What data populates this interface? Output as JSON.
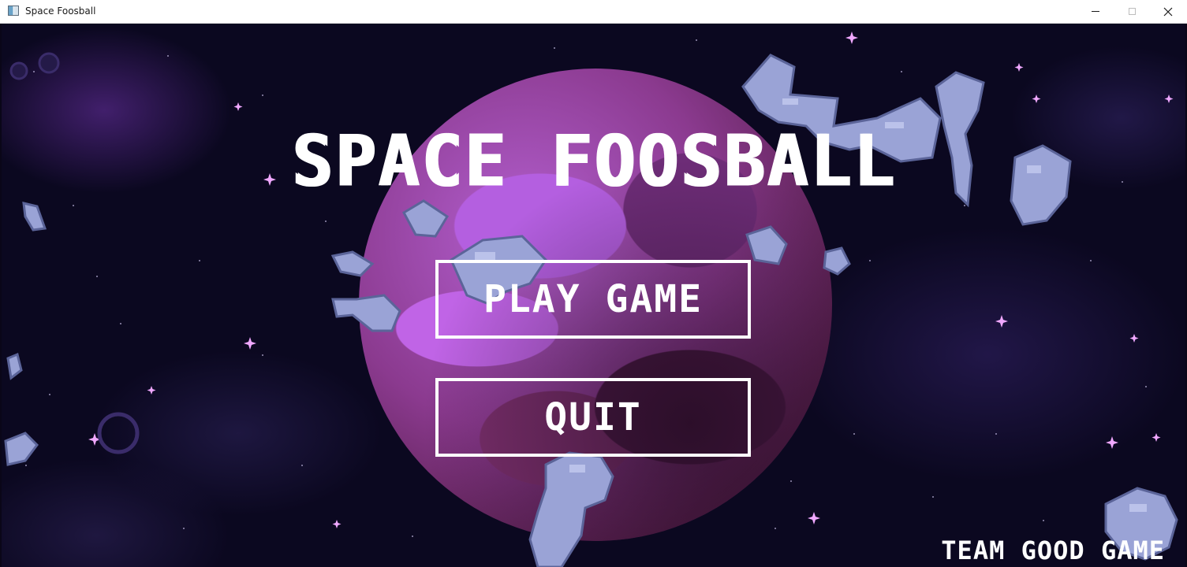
{
  "window": {
    "title": "Space Foosball",
    "app_icon": "app-window-icon",
    "controls": {
      "minimize_icon": "minimize-icon",
      "maximize_icon": "maximize-icon",
      "close_icon": "close-icon",
      "close_glyph": "✕"
    }
  },
  "game": {
    "title": "SPACE FOOSBALL",
    "menu": {
      "play_label": "PLAY GAME",
      "quit_label": "QUIT"
    },
    "credits": "TEAM GOOD GAME"
  },
  "colors": {
    "background": "#0b0820",
    "planet_light": "#b35fcf",
    "planet_dark": "#3a1232",
    "asteroid": "#9aa3d6",
    "star": "#e9a6f0",
    "text": "#ffffff"
  }
}
